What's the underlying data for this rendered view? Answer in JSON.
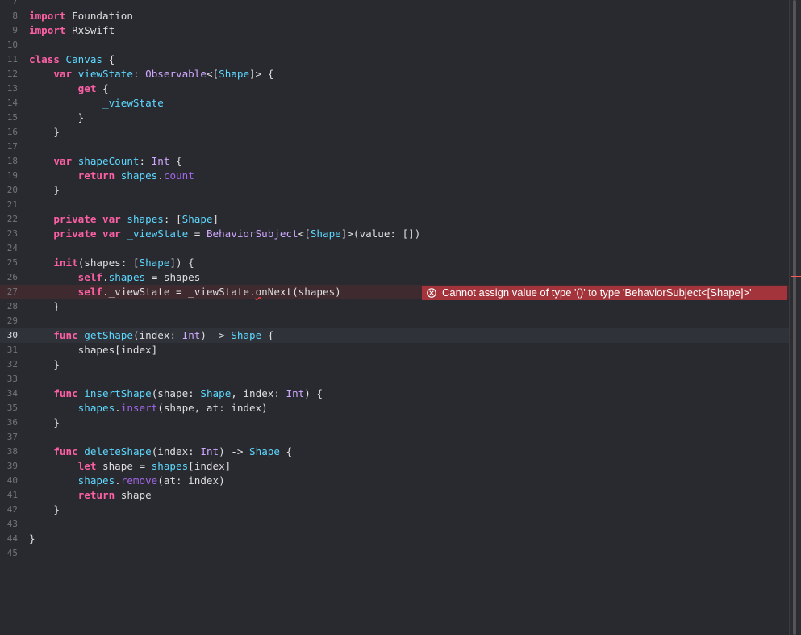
{
  "editor": {
    "lines": [
      {
        "number": "7",
        "tokens": []
      },
      {
        "number": "8",
        "tokens": [
          {
            "t": "import",
            "c": "kw"
          },
          {
            "t": " Foundation",
            "c": "pl"
          }
        ]
      },
      {
        "number": "9",
        "tokens": [
          {
            "t": "import",
            "c": "kw"
          },
          {
            "t": " RxSwift",
            "c": "pl"
          }
        ]
      },
      {
        "number": "10",
        "tokens": []
      },
      {
        "number": "11",
        "tokens": [
          {
            "t": "class",
            "c": "kw"
          },
          {
            "t": " ",
            "c": "pl"
          },
          {
            "t": "Canvas",
            "c": "tn"
          },
          {
            "t": " {",
            "c": "pl"
          }
        ]
      },
      {
        "number": "12",
        "tokens": [
          {
            "t": "    ",
            "c": "pl"
          },
          {
            "t": "var",
            "c": "kw"
          },
          {
            "t": " ",
            "c": "pl"
          },
          {
            "t": "viewState",
            "c": "tn"
          },
          {
            "t": ": ",
            "c": "pl"
          },
          {
            "t": "Observable",
            "c": "tp"
          },
          {
            "t": "<[",
            "c": "pl"
          },
          {
            "t": "Shape",
            "c": "tn"
          },
          {
            "t": "]> {",
            "c": "pl"
          }
        ]
      },
      {
        "number": "13",
        "tokens": [
          {
            "t": "        ",
            "c": "pl"
          },
          {
            "t": "get",
            "c": "kw"
          },
          {
            "t": " {",
            "c": "pl"
          }
        ]
      },
      {
        "number": "14",
        "tokens": [
          {
            "t": "            ",
            "c": "pl"
          },
          {
            "t": "_viewState",
            "c": "tn"
          }
        ]
      },
      {
        "number": "15",
        "tokens": [
          {
            "t": "        }",
            "c": "pl"
          }
        ]
      },
      {
        "number": "16",
        "tokens": [
          {
            "t": "    }",
            "c": "pl"
          }
        ]
      },
      {
        "number": "17",
        "tokens": []
      },
      {
        "number": "18",
        "tokens": [
          {
            "t": "    ",
            "c": "pl"
          },
          {
            "t": "var",
            "c": "kw"
          },
          {
            "t": " ",
            "c": "pl"
          },
          {
            "t": "shapeCount",
            "c": "tn"
          },
          {
            "t": ": ",
            "c": "pl"
          },
          {
            "t": "Int",
            "c": "tp"
          },
          {
            "t": " {",
            "c": "pl"
          }
        ]
      },
      {
        "number": "19",
        "tokens": [
          {
            "t": "        ",
            "c": "pl"
          },
          {
            "t": "return",
            "c": "kw"
          },
          {
            "t": " ",
            "c": "pl"
          },
          {
            "t": "shapes",
            "c": "tn"
          },
          {
            "t": ".",
            "c": "pl"
          },
          {
            "t": "count",
            "c": "tu"
          }
        ]
      },
      {
        "number": "20",
        "tokens": [
          {
            "t": "    }",
            "c": "pl"
          }
        ]
      },
      {
        "number": "21",
        "tokens": []
      },
      {
        "number": "22",
        "tokens": [
          {
            "t": "    ",
            "c": "pl"
          },
          {
            "t": "private",
            "c": "kw"
          },
          {
            "t": " ",
            "c": "pl"
          },
          {
            "t": "var",
            "c": "kw"
          },
          {
            "t": " ",
            "c": "pl"
          },
          {
            "t": "shapes",
            "c": "tn"
          },
          {
            "t": ": [",
            "c": "pl"
          },
          {
            "t": "Shape",
            "c": "tn"
          },
          {
            "t": "]",
            "c": "pl"
          }
        ]
      },
      {
        "number": "23",
        "tokens": [
          {
            "t": "    ",
            "c": "pl"
          },
          {
            "t": "private",
            "c": "kw"
          },
          {
            "t": " ",
            "c": "pl"
          },
          {
            "t": "var",
            "c": "kw"
          },
          {
            "t": " ",
            "c": "pl"
          },
          {
            "t": "_viewState",
            "c": "tn"
          },
          {
            "t": " = ",
            "c": "pl"
          },
          {
            "t": "BehaviorSubject",
            "c": "tp"
          },
          {
            "t": "<[",
            "c": "pl"
          },
          {
            "t": "Shape",
            "c": "tn"
          },
          {
            "t": "]>(value: [])",
            "c": "pl"
          }
        ]
      },
      {
        "number": "24",
        "tokens": []
      },
      {
        "number": "25",
        "tokens": [
          {
            "t": "    ",
            "c": "pl"
          },
          {
            "t": "init",
            "c": "kw"
          },
          {
            "t": "(shapes: [",
            "c": "pl"
          },
          {
            "t": "Shape",
            "c": "tn"
          },
          {
            "t": "]) {",
            "c": "pl"
          }
        ]
      },
      {
        "number": "26",
        "tokens": [
          {
            "t": "        ",
            "c": "pl"
          },
          {
            "t": "self",
            "c": "kw"
          },
          {
            "t": ".",
            "c": "pl"
          },
          {
            "t": "shapes",
            "c": "tn"
          },
          {
            "t": " = shapes",
            "c": "pl"
          }
        ]
      },
      {
        "number": "27",
        "error": true,
        "tokens": [
          {
            "t": "        ",
            "c": "pl"
          },
          {
            "t": "self",
            "c": "kw"
          },
          {
            "t": "._viewState = _viewState.",
            "c": "pl"
          },
          {
            "t": "o",
            "c": "pl ul"
          },
          {
            "t": "nNext(shapes)",
            "c": "pl"
          }
        ]
      },
      {
        "number": "28",
        "tokens": [
          {
            "t": "    }",
            "c": "pl"
          }
        ]
      },
      {
        "number": "29",
        "tokens": []
      },
      {
        "number": "30",
        "current": true,
        "tokens": [
          {
            "t": "    ",
            "c": "pl"
          },
          {
            "t": "func",
            "c": "kw"
          },
          {
            "t": " ",
            "c": "pl"
          },
          {
            "t": "getShape",
            "c": "tn"
          },
          {
            "t": "(index: ",
            "c": "pl"
          },
          {
            "t": "Int",
            "c": "tp"
          },
          {
            "t": ") -> ",
            "c": "pl"
          },
          {
            "t": "Shape",
            "c": "tn"
          },
          {
            "t": " {",
            "c": "pl"
          }
        ]
      },
      {
        "number": "31",
        "tokens": [
          {
            "t": "        shapes[index]",
            "c": "pl"
          }
        ]
      },
      {
        "number": "32",
        "tokens": [
          {
            "t": "    }",
            "c": "pl"
          }
        ]
      },
      {
        "number": "33",
        "tokens": []
      },
      {
        "number": "34",
        "tokens": [
          {
            "t": "    ",
            "c": "pl"
          },
          {
            "t": "func",
            "c": "kw"
          },
          {
            "t": " ",
            "c": "pl"
          },
          {
            "t": "insertShape",
            "c": "tn"
          },
          {
            "t": "(shape: ",
            "c": "pl"
          },
          {
            "t": "Shape",
            "c": "tn"
          },
          {
            "t": ", index: ",
            "c": "pl"
          },
          {
            "t": "Int",
            "c": "tp"
          },
          {
            "t": ") {",
            "c": "pl"
          }
        ]
      },
      {
        "number": "35",
        "tokens": [
          {
            "t": "        ",
            "c": "pl"
          },
          {
            "t": "shapes",
            "c": "tn"
          },
          {
            "t": ".",
            "c": "pl"
          },
          {
            "t": "insert",
            "c": "tu"
          },
          {
            "t": "(shape, at: index)",
            "c": "pl"
          }
        ]
      },
      {
        "number": "36",
        "tokens": [
          {
            "t": "    }",
            "c": "pl"
          }
        ]
      },
      {
        "number": "37",
        "tokens": []
      },
      {
        "number": "38",
        "tokens": [
          {
            "t": "    ",
            "c": "pl"
          },
          {
            "t": "func",
            "c": "kw"
          },
          {
            "t": " ",
            "c": "pl"
          },
          {
            "t": "deleteShape",
            "c": "tn"
          },
          {
            "t": "(index: ",
            "c": "pl"
          },
          {
            "t": "Int",
            "c": "tp"
          },
          {
            "t": ") -> ",
            "c": "pl"
          },
          {
            "t": "Shape",
            "c": "tn"
          },
          {
            "t": " {",
            "c": "pl"
          }
        ]
      },
      {
        "number": "39",
        "tokens": [
          {
            "t": "        ",
            "c": "pl"
          },
          {
            "t": "let",
            "c": "kw"
          },
          {
            "t": " shape = ",
            "c": "pl"
          },
          {
            "t": "shapes",
            "c": "tn"
          },
          {
            "t": "[index]",
            "c": "pl"
          }
        ]
      },
      {
        "number": "40",
        "tokens": [
          {
            "t": "        ",
            "c": "pl"
          },
          {
            "t": "shapes",
            "c": "tn"
          },
          {
            "t": ".",
            "c": "pl"
          },
          {
            "t": "remove",
            "c": "tu"
          },
          {
            "t": "(at: index)",
            "c": "pl"
          }
        ]
      },
      {
        "number": "41",
        "tokens": [
          {
            "t": "        ",
            "c": "pl"
          },
          {
            "t": "return",
            "c": "kw"
          },
          {
            "t": " shape",
            "c": "pl"
          }
        ]
      },
      {
        "number": "42",
        "tokens": [
          {
            "t": "    }",
            "c": "pl"
          }
        ]
      },
      {
        "number": "43",
        "tokens": []
      },
      {
        "number": "44",
        "tokens": [
          {
            "t": "}",
            "c": "pl"
          }
        ]
      },
      {
        "number": "45",
        "tokens": []
      }
    ]
  },
  "error": {
    "message": "Cannot assign value of type '()' to type 'BehaviorSubject<[Shape]>'",
    "icon": "error-circle-x-icon",
    "color": "#a3343c"
  },
  "colors": {
    "background": "#292a30",
    "keyword": "#fc5fa3",
    "type": "#d0a8ff",
    "identifier": "#5dd8ff",
    "plain": "#dfdfe0",
    "line_number": "#747478"
  }
}
